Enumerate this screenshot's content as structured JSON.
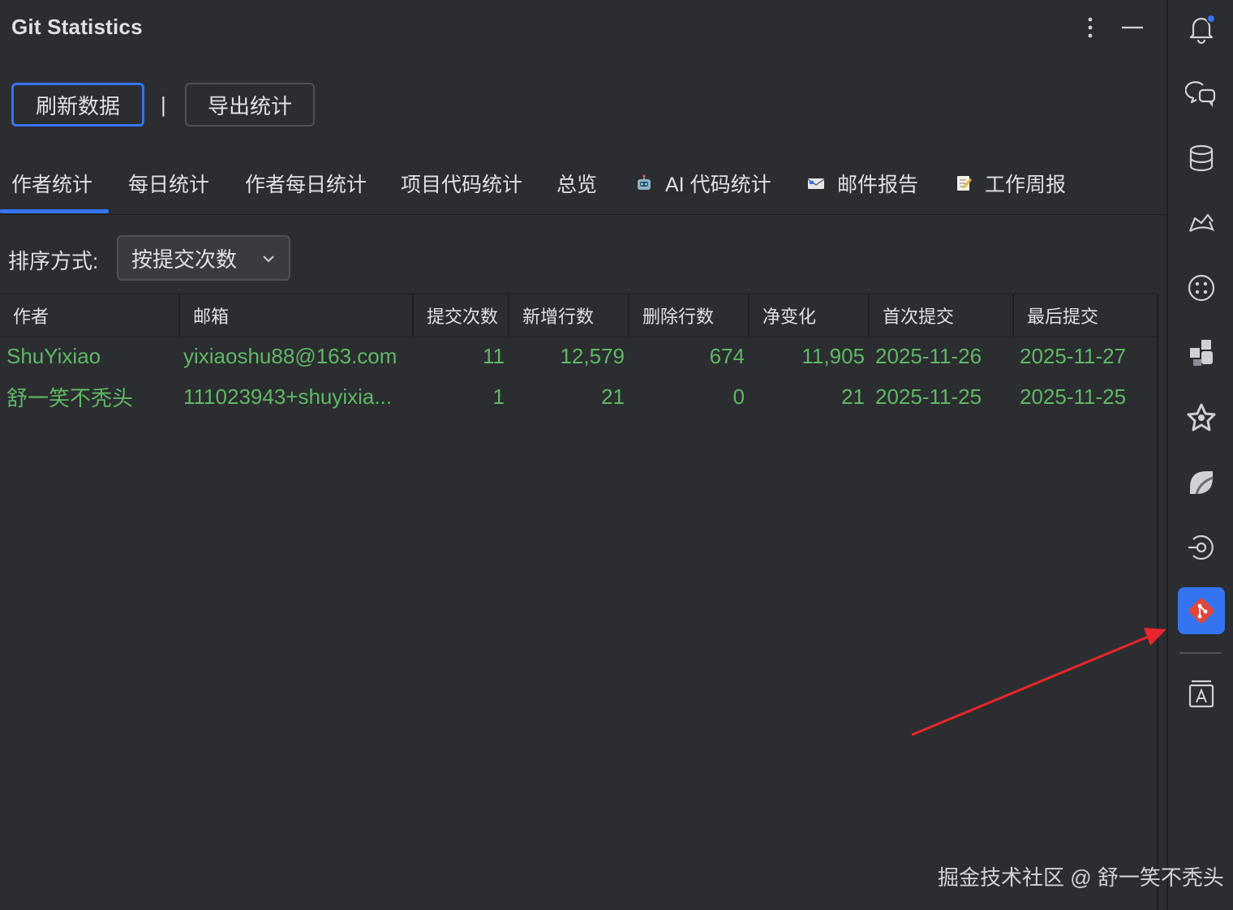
{
  "panel": {
    "title": "Git Statistics"
  },
  "toolbar": {
    "refresh_label": "刷新数据",
    "separator": "|",
    "export_label": "导出统计"
  },
  "tabs": [
    {
      "label": "作者统计",
      "active": true
    },
    {
      "label": "每日统计"
    },
    {
      "label": "作者每日统计"
    },
    {
      "label": "项目代码统计"
    },
    {
      "label": "总览"
    },
    {
      "label": "AI 代码统计",
      "icon": "robot-icon"
    },
    {
      "label": "邮件报告",
      "icon": "envelope-icon"
    },
    {
      "label": "工作周报",
      "icon": "memo-icon"
    }
  ],
  "sort": {
    "label": "排序方式:",
    "value": "按提交次数"
  },
  "table": {
    "columns": [
      "作者",
      "邮箱",
      "提交次数",
      "新增行数",
      "删除行数",
      "净变化",
      "首次提交",
      "最后提交"
    ],
    "rows": [
      [
        "ShuYixiao",
        "yixiaoshu88@163.com",
        "11",
        "12,579",
        "674",
        "11,905",
        "2025-11-26",
        "2025-11-27"
      ],
      [
        "舒一笑不秃头",
        "111023943+shuyixia...",
        "1",
        "21",
        "0",
        "21",
        "2025-11-25",
        "2025-11-25"
      ]
    ]
  },
  "tool_strip": [
    "bell-icon",
    "chat-icon",
    "database-icon",
    "chart-icon",
    "plugin-icon",
    "puzzle-icon",
    "star-icon",
    "leaf-icon",
    "target-icon",
    "git-icon",
    "translate-icon"
  ],
  "colors": {
    "accent": "#3574f0",
    "row_text": "#5fb865",
    "background": "#2b2d30",
    "arrow": "#e8262b",
    "git_red": "#e0463a"
  },
  "watermark": "掘金技术社区 @ 舒一笑不秃头"
}
